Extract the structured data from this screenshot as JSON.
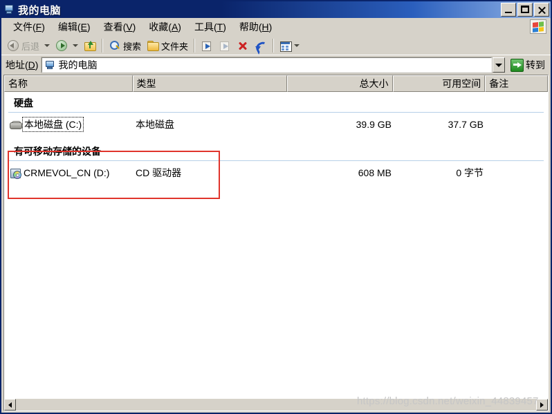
{
  "window": {
    "title": "我的电脑",
    "title_icon": "my-computer-icon",
    "buttons": {
      "minimize": "_",
      "maximize": "□",
      "close": "✕"
    }
  },
  "menu": {
    "items": [
      {
        "label": "文件(F)",
        "pre": "文件(",
        "key": "F",
        "post": ")"
      },
      {
        "label": "编辑(E)",
        "pre": "编辑(",
        "key": "E",
        "post": ")"
      },
      {
        "label": "查看(V)",
        "pre": "查看(",
        "key": "V",
        "post": ")"
      },
      {
        "label": "收藏(A)",
        "pre": "收藏(",
        "key": "A",
        "post": ")"
      },
      {
        "label": "工具(T)",
        "pre": "工具(",
        "key": "T",
        "post": ")"
      },
      {
        "label": "帮助(H)",
        "pre": "帮助(",
        "key": "H",
        "post": ")"
      }
    ],
    "windows_flag": "windows-logo-icon"
  },
  "toolbar": {
    "back_label": "后退",
    "forward_label": "",
    "up_label": "",
    "search_label": "搜索",
    "folders_label": "文件夹",
    "move_to_label": "",
    "copy_to_label": "",
    "delete_label": "",
    "undo_label": "",
    "views_label": ""
  },
  "address": {
    "label": "地址(D)",
    "label_pre": "地址(",
    "label_key": "D",
    "label_post": ")",
    "value": "我的电脑",
    "placeholder": "我的电脑",
    "go_label": "转到"
  },
  "columns": [
    {
      "label": "名称",
      "align": "left"
    },
    {
      "label": "类型",
      "align": "left"
    },
    {
      "label": "总大小",
      "align": "right"
    },
    {
      "label": "可用空间",
      "align": "right"
    },
    {
      "label": "备注",
      "align": "left"
    }
  ],
  "groups": [
    {
      "title": "硬盘",
      "items": [
        {
          "name": "本地磁盘 (C:)",
          "type": "本地磁盘",
          "total_size": "39.9 GB",
          "free_space": "37.7 GB",
          "comment": "",
          "icon": "hard-disk-icon",
          "focused": true
        }
      ]
    },
    {
      "title": "有可移动存储的设备",
      "items": [
        {
          "name": "CRMEVOL_CN (D:)",
          "type": "CD 驱动器",
          "total_size": "608 MB",
          "free_space": "0 字节",
          "comment": "",
          "icon": "cd-drive-icon",
          "focused": false
        }
      ]
    }
  ],
  "annotation": {
    "color": "#e0342b",
    "shape": "rectangle"
  },
  "scrollbar": {
    "left_arrow": "◀",
    "right_arrow": "▶"
  },
  "watermark": {
    "text": "https://blog.csdn.net/weixin_44839457"
  }
}
